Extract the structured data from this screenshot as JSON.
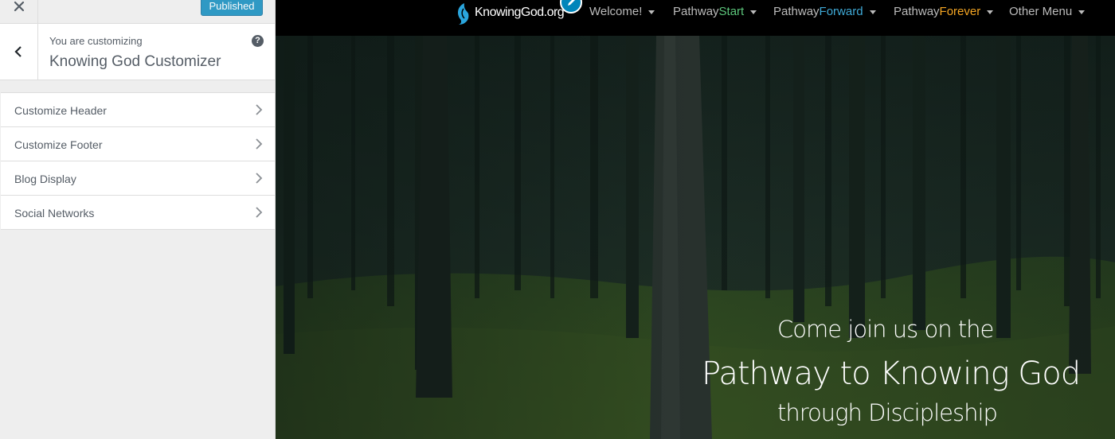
{
  "customizer": {
    "close_label": "Close",
    "publish_label": "Published",
    "info": {
      "customizing_label": "You are customizing",
      "title": "Knowing God Customizer",
      "help_label": "?"
    },
    "sections": [
      {
        "label": "Customize Header"
      },
      {
        "label": "Customize Footer"
      },
      {
        "label": "Blog Display"
      },
      {
        "label": "Social Networks"
      }
    ]
  },
  "preview": {
    "logo_text": "KnowingGod.org",
    "nav": [
      {
        "prefix": "Welcome!",
        "suffix": "",
        "suffix_color": ""
      },
      {
        "prefix": "Pathway",
        "suffix": "Start",
        "suffix_color": "#5cc57b"
      },
      {
        "prefix": "Pathway",
        "suffix": "Forward",
        "suffix_color": "#3fa9d6"
      },
      {
        "prefix": "Pathway",
        "suffix": "Forever",
        "suffix_color": "#f5a623"
      },
      {
        "prefix": "Other Menu",
        "suffix": "",
        "suffix_color": ""
      }
    ],
    "hero": {
      "line1": "Come join us on the",
      "line2": "Pathway to Knowing God",
      "line3": "through Discipleship"
    }
  },
  "colors": {
    "accent": "#0085ba",
    "navbar_bg": "#000000",
    "sidebar_bg": "#eeeeee",
    "text_muted": "#555d66"
  },
  "icons": {
    "close": "close-icon",
    "back": "chevron-left-icon",
    "help": "help-icon",
    "section": "chevron-right-icon",
    "logo": "flame-logo-icon",
    "edit": "pencil-icon",
    "dropdown": "caret-down-icon"
  }
}
